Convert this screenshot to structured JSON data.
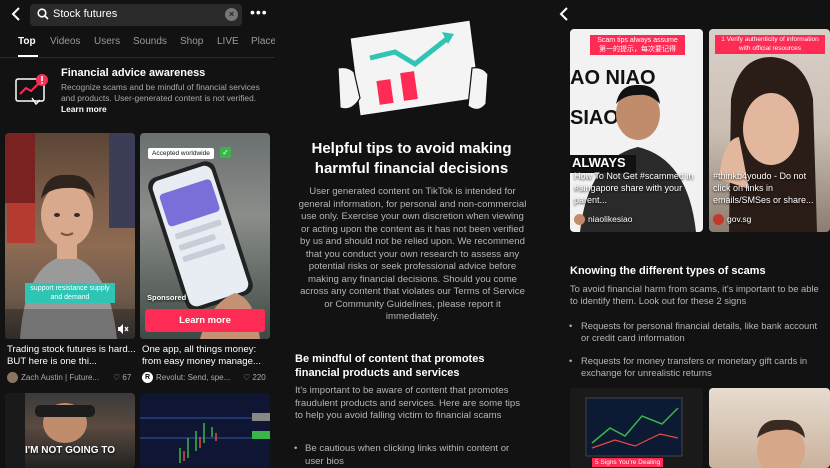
{
  "search": {
    "query": "Stock futures",
    "more_label": "•••"
  },
  "tabs": [
    "Top",
    "Videos",
    "Users",
    "Sounds",
    "Shop",
    "LIVE",
    "Place"
  ],
  "advice_banner": {
    "title": "Financial advice awareness",
    "body": "Recognize scams and be mindful of financial services and products. User-generated content is not verified.",
    "link": "Learn more"
  },
  "videos": [
    {
      "caption": "support resistance supply and demand",
      "title": "Trading stock futures is hard... BUT here is one thi...",
      "author": "Zach Austin | Future...",
      "likes": "67"
    },
    {
      "badge": "Accepted worldwide",
      "sponsored": "Sponsored",
      "cta": "Learn more",
      "title": "One app, all things money: from easy money manage...",
      "author": "Revolut: Send, spe...",
      "likes": "220"
    },
    {
      "overlay": "I'M NOT GOING TO"
    },
    {}
  ],
  "panel2": {
    "title": "Helpful tips to avoid making harmful financial decisions",
    "body": "User generated content on TikTok is intended for general information, for personal and non-commercial use only. Exercise your own discretion when viewing or acting upon the content as it has not been verified by us and should not be relied upon. We recommend that you conduct your own research to assess any potential risks or seek professional advice before making any financial decisions. Should you come across any content that violates our Terms of Service or Community Guidelines, please report it immediately.",
    "subtitle": "Be mindful of content that promotes financial products and services",
    "sub_body": "It's important to be aware of content that promotes fraudulent products and services. Here are some tips to help you avoid falling victim to financial scams",
    "bullets": [
      "Be cautious when clicking links within content or user bios"
    ]
  },
  "panel3": {
    "videos": [
      {
        "top_caption": "Scam tips always assume",
        "top_caption2": "第一的提示，每次要记得",
        "overlay": "ALWAYS",
        "title": "How To Not Get #scammed in #singapore share with your parent...",
        "author": "niaolikesiao"
      },
      {
        "top_caption": "1 Verify authenticity of information with official resources",
        "title": "#thinkb4youdo - Do not click on links in emails/SMSes or share...",
        "author": "gov.sg"
      },
      {
        "overlay": "5 Signs You're Dealing"
      },
      {}
    ],
    "section_title": "Knowing the different types of scams",
    "section_body": "To avoid financial harm from scams, it's important to be able to identify them. Look out for these 2 signs",
    "bullets": [
      "Requests for personal financial details, like bank account or credit card information",
      "Requests for money transfers or monetary gift cards in exchange for unrealistic returns"
    ]
  },
  "colors": {
    "accent": "#fe2c55",
    "teal": "#2fc5b5",
    "badge_green": "#39b54a"
  }
}
